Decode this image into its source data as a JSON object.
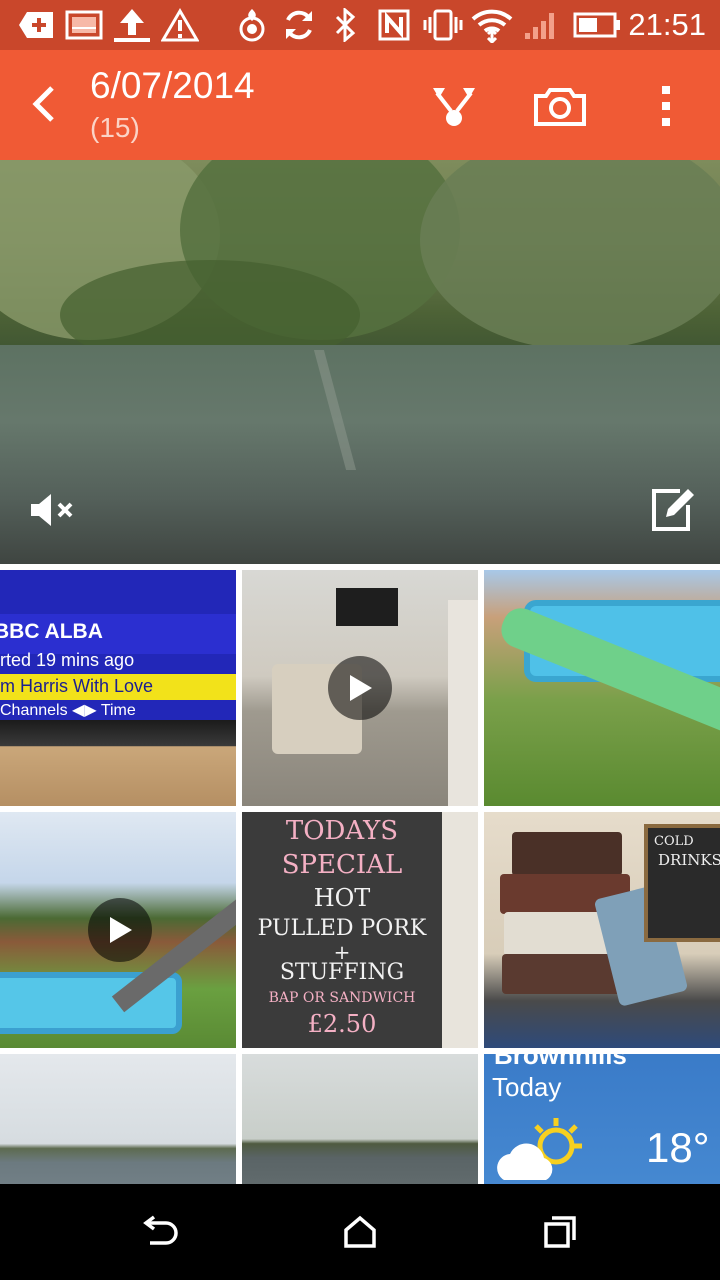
{
  "status_bar": {
    "time": "21:51",
    "icons": [
      "add-notification-icon",
      "gallery-notification-icon",
      "upload-icon",
      "warning-icon",
      "location-icon",
      "sync-icon",
      "bluetooth-icon",
      "nfc-icon",
      "vibrate-icon",
      "wifi-icon",
      "signal-icon",
      "battery-icon"
    ]
  },
  "app_bar": {
    "title": "6/07/2014",
    "subtitle": "(15)",
    "actions": [
      "share-icon",
      "camera-icon",
      "overflow-menu-icon"
    ]
  },
  "hero": {
    "icons": [
      "mute-icon",
      "edit-icon"
    ]
  },
  "grid": {
    "thumbs": [
      {
        "name": "tv-screen-photo",
        "lines": [
          "BBC ALBA",
          "rted 19 mins ago",
          "m Harris With Love",
          "Channels ◀▶ Time"
        ]
      },
      {
        "name": "living-room-video",
        "video": true
      },
      {
        "name": "paddling-pool-slide-photo"
      },
      {
        "name": "garden-pool-video",
        "video": true
      },
      {
        "name": "chalkboard-photo",
        "lines": [
          "TODAYS",
          "SPECIAL",
          "HOT",
          "PULLED PORK",
          "+",
          "STUFFING",
          "BAP OR SANDWICH",
          "£2.50"
        ]
      },
      {
        "name": "suitcases-photo",
        "sign": [
          "COLD",
          "DRINKS"
        ]
      },
      {
        "name": "lake-photo-1"
      },
      {
        "name": "lake-photo-2"
      },
      {
        "name": "weather-widget-photo",
        "location": "Brownhills",
        "day": "Today",
        "temperature": "18°"
      }
    ]
  },
  "nav_bar": {
    "buttons": [
      "back-nav-icon",
      "home-nav-icon",
      "recents-nav-icon"
    ]
  }
}
